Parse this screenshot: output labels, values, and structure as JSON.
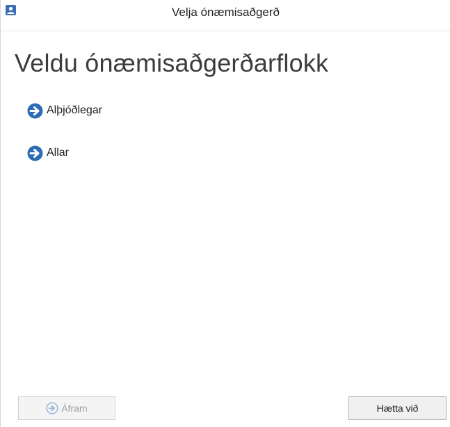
{
  "window": {
    "title": "Velja ónæmisaðgerð",
    "app_icon": "user-card-icon"
  },
  "page": {
    "heading": "Veldu ónæmisaðgerðarflokk"
  },
  "options": [
    {
      "label": "Alþjóðlegar",
      "icon": "arrow-right-circle-icon"
    },
    {
      "label": "Allar",
      "icon": "arrow-right-circle-icon"
    }
  ],
  "footer": {
    "next_label": "Áfram",
    "next_enabled": false,
    "next_icon": "arrow-right-circle-icon",
    "cancel_label": "Hætta við"
  },
  "colors": {
    "accent": "#2b6cb4",
    "disabled_text": "#a0a0a0"
  }
}
